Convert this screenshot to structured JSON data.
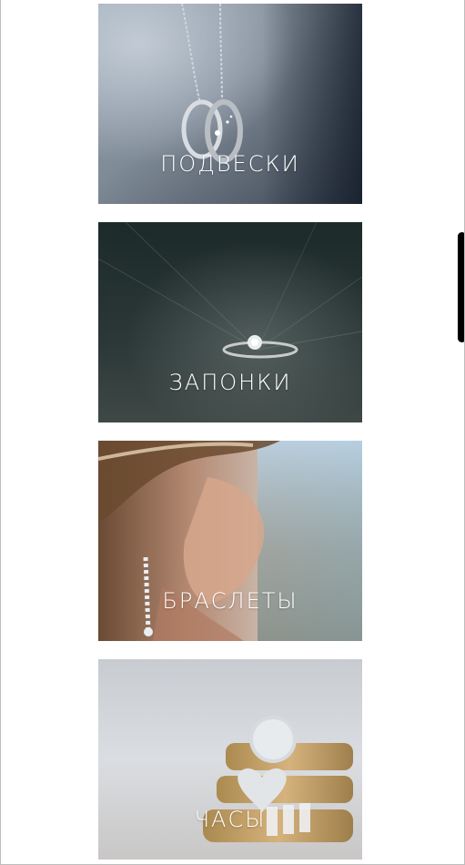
{
  "categories": [
    {
      "label": "ПОДВЕСКИ",
      "image": "pendant-rings-on-chain"
    },
    {
      "label": "ЗАПОНКИ",
      "image": "diamond-solitaire-ring"
    },
    {
      "label": "БРАСЛЕТЫ",
      "image": "woman-with-drop-earring"
    },
    {
      "label": "ЧАСЫ",
      "image": "gold-pave-rings"
    }
  ],
  "colors": {
    "label_text": "#ffffff",
    "scrollbar_thumb": "#000000",
    "page_background": "#ffffff"
  }
}
